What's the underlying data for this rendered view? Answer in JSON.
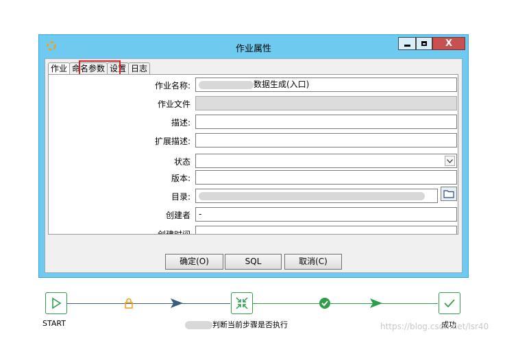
{
  "dialog": {
    "title": "作业属性",
    "close_label": "X",
    "tabs": [
      {
        "label": "作业"
      },
      {
        "label": "命名参数"
      },
      {
        "label": "设置"
      },
      {
        "label": "日志"
      }
    ],
    "fields": {
      "job_name_label": "作业名称:",
      "job_name_value": "数据生成(入口)",
      "job_file_label": "作业文件",
      "description_label": "描述:",
      "ext_description_label": "扩展描述:",
      "status_label": "状态",
      "version_label": "版本:",
      "directory_label": "目录:",
      "creator_label": "创建者",
      "creator_value": "-",
      "created_time_label": "创建时间"
    },
    "buttons": {
      "ok": "确定(O)",
      "sql": "SQL",
      "cancel": "取消(C)"
    }
  },
  "workflow": {
    "start_label": "START",
    "step_label": "判断当前步骤是否执行",
    "success_label": "成功",
    "colors": {
      "node_border": "#2e9e4a",
      "lock": "#f0a020",
      "arrow_dark": "#3a5a80",
      "link_green": "#2e9e4a"
    }
  },
  "watermark": "https://blog.csdn.net/lsr40",
  "colors": {
    "title_bar": "#6ecbef",
    "highlight": "#e02020"
  }
}
